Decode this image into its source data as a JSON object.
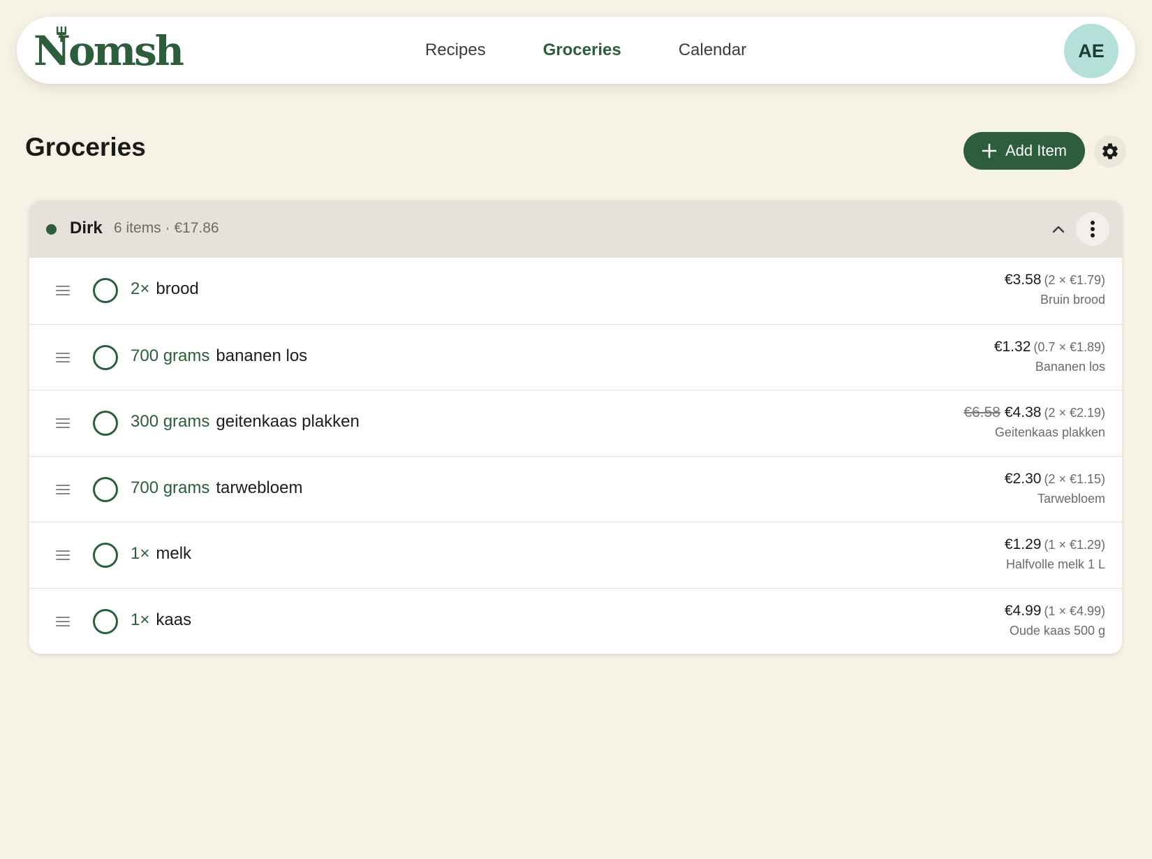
{
  "app": {
    "logo_text": "Nomsh",
    "brand_color": "#2c5e3c"
  },
  "nav": {
    "links": [
      {
        "label": "Recipes",
        "active": false
      },
      {
        "label": "Groceries",
        "active": true
      },
      {
        "label": "Calendar",
        "active": false
      }
    ],
    "avatar_initials": "AE"
  },
  "page": {
    "title": "Groceries",
    "add_item_label": "Add Item",
    "add_icon": "plus-icon",
    "settings_icon": "gear-icon"
  },
  "store": {
    "name": "Dirk",
    "summary": "6 items · €17.86",
    "collapse_icon": "chevron-up-icon",
    "menu_icon": "more-vertical-icon",
    "items": [
      {
        "qty": "2×",
        "name": "brood",
        "old_price": "",
        "total": "€3.58",
        "calc": "(2 × €1.79)",
        "product": "Bruin brood"
      },
      {
        "qty": "700 grams",
        "name": "bananen los",
        "old_price": "",
        "total": "€1.32",
        "calc": "(0.7 × €1.89)",
        "product": "Bananen los"
      },
      {
        "qty": "300 grams",
        "name": "geitenkaas plakken",
        "old_price": "€6.58",
        "total": "€4.38",
        "calc": "(2 × €2.19)",
        "product": "Geitenkaas plakken"
      },
      {
        "qty": "700 grams",
        "name": "tarwebloem",
        "old_price": "",
        "total": "€2.30",
        "calc": "(2 × €1.15)",
        "product": "Tarwebloem"
      },
      {
        "qty": "1×",
        "name": "melk",
        "old_price": "",
        "total": "€1.29",
        "calc": "(1 × €1.29)",
        "product": "Halfvolle melk 1 L"
      },
      {
        "qty": "1×",
        "name": "kaas",
        "old_price": "",
        "total": "€4.99",
        "calc": "(1 × €4.99)",
        "product": "Oude kaas 500 g"
      }
    ]
  }
}
